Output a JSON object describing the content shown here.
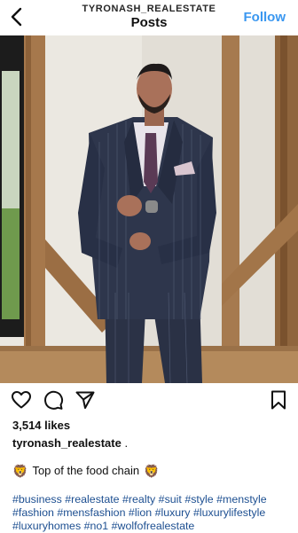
{
  "header": {
    "username": "TYRONASH_REALESTATE",
    "title": "Posts",
    "follow_label": "Follow"
  },
  "post": {
    "likes": "3,514 likes",
    "poster_username": "tyronash_realestate",
    "poster_suffix": " .",
    "caption_text": "Top of the food chain",
    "caption_emoji": "🦁",
    "hashtags": [
      "#business",
      "#realestate",
      "#realty",
      "#suit",
      "#style",
      "#menstyle",
      "#fashion",
      "#mensfashion",
      "#lion",
      "#luxury",
      "#luxurylifestyle",
      "#luxuryhomes",
      "#no1",
      "#wolfofrealestate"
    ]
  },
  "icons": {
    "back": "chevron-left-icon",
    "like": "heart-icon",
    "comment": "comment-bubble-icon",
    "share": "paper-plane-icon",
    "save": "bookmark-icon"
  },
  "colors": {
    "accent": "#3a97f0",
    "hashtag": "#1d4f91"
  }
}
